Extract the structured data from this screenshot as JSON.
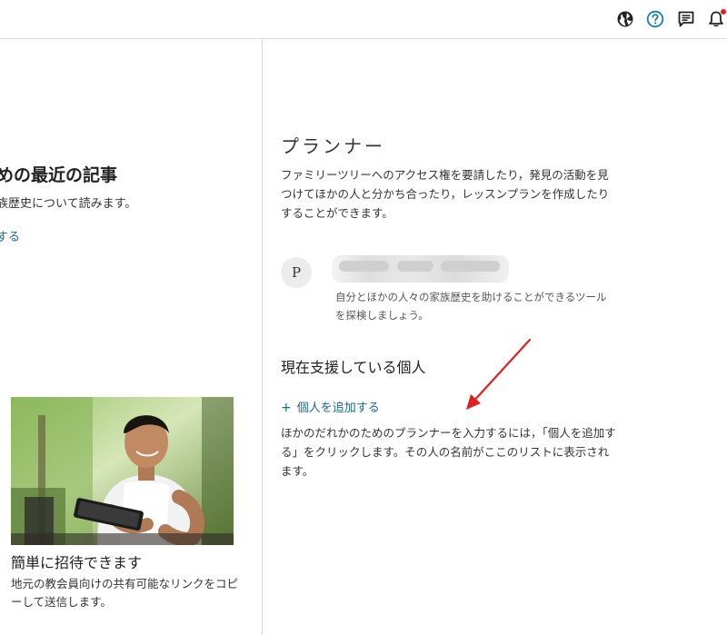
{
  "header": {
    "icons": [
      "globe-icon",
      "help-icon",
      "messages-icon",
      "notifications-icon"
    ],
    "accent_color": "#1a7fa8",
    "notification_dot_color": "#e02020"
  },
  "left": {
    "title": "めの最近の記事",
    "subtitle": "族歴史について読みます。",
    "link": "する",
    "card": {
      "title": "簡単に招待できます",
      "description": "地元の教会員向けの共有可能なリンクをコピーして送信します。"
    }
  },
  "planner": {
    "title": "プランナー",
    "description": "ファミリーツリーへのアクセス権を要請したり，発見の活動を見つけてほかの人と分かち合ったり，レッスンプランを作成したりすることができます。",
    "person": {
      "initial": "P",
      "description": "自分とほかの人々の家族歴史を助けることができるツールを探検しましょう。"
    },
    "supporting_title": "現在支援している個人",
    "add_link": "個人を追加する",
    "add_description": "ほかのだれかのためのプランナーを入力するには，「個人を追加する」をクリックします。その人の名前がここのリストに表示されます。"
  }
}
